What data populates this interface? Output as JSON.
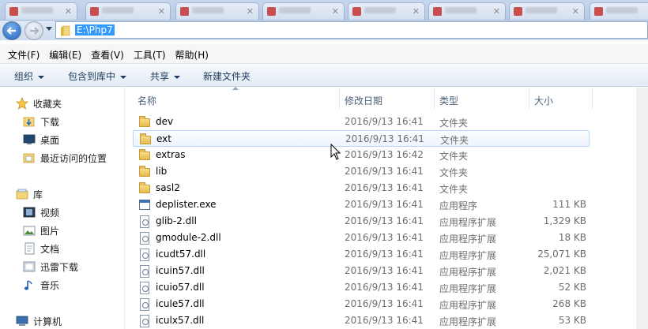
{
  "address": {
    "path": "E:\\Php7"
  },
  "menu": [
    "文件(F)",
    "编辑(E)",
    "查看(V)",
    "工具(T)",
    "帮助(H)"
  ],
  "commands": [
    {
      "label": "组织",
      "dropdown": true
    },
    {
      "label": "包含到库中",
      "dropdown": true
    },
    {
      "label": "共享",
      "dropdown": true
    },
    {
      "label": "新建文件夹",
      "dropdown": false
    }
  ],
  "nav": {
    "favorites": "收藏夹",
    "favorites_items": [
      "下载",
      "桌面",
      "最近访问的位置"
    ],
    "libraries": "库",
    "library_items": [
      "视频",
      "图片",
      "文档",
      "迅雷下载",
      "音乐"
    ],
    "computer": "计算机"
  },
  "columns": {
    "name": "名称",
    "date": "修改日期",
    "type": "类型",
    "size": "大小"
  },
  "files": [
    {
      "name": "dev",
      "date": "2016/9/13 16:41",
      "type": "文件夹",
      "size": "",
      "kind": "folder"
    },
    {
      "name": "ext",
      "date": "2016/9/13 16:41",
      "type": "文件夹",
      "size": "",
      "kind": "folder"
    },
    {
      "name": "extras",
      "date": "2016/9/13 16:42",
      "type": "文件夹",
      "size": "",
      "kind": "folder"
    },
    {
      "name": "lib",
      "date": "2016/9/13 16:41",
      "type": "文件夹",
      "size": "",
      "kind": "folder"
    },
    {
      "name": "sasl2",
      "date": "2016/9/13 16:41",
      "type": "文件夹",
      "size": "",
      "kind": "folder"
    },
    {
      "name": "deplister.exe",
      "date": "2016/9/13 16:41",
      "type": "应用程序",
      "size": "111 KB",
      "kind": "exe"
    },
    {
      "name": "glib-2.dll",
      "date": "2016/9/13 16:41",
      "type": "应用程序扩展",
      "size": "1,329 KB",
      "kind": "dll"
    },
    {
      "name": "gmodule-2.dll",
      "date": "2016/9/13 16:41",
      "type": "应用程序扩展",
      "size": "18 KB",
      "kind": "dll"
    },
    {
      "name": "icudt57.dll",
      "date": "2016/9/13 16:41",
      "type": "应用程序扩展",
      "size": "25,071 KB",
      "kind": "dll"
    },
    {
      "name": "icuin57.dll",
      "date": "2016/9/13 16:41",
      "type": "应用程序扩展",
      "size": "2,021 KB",
      "kind": "dll"
    },
    {
      "name": "icuio57.dll",
      "date": "2016/9/13 16:41",
      "type": "应用程序扩展",
      "size": "52 KB",
      "kind": "dll"
    },
    {
      "name": "icule57.dll",
      "date": "2016/9/13 16:41",
      "type": "应用程序扩展",
      "size": "268 KB",
      "kind": "dll"
    },
    {
      "name": "iculx57.dll",
      "date": "2016/9/13 16:41",
      "type": "应用程序扩展",
      "size": "53 KB",
      "kind": "dll"
    }
  ],
  "hovered_row": 1
}
